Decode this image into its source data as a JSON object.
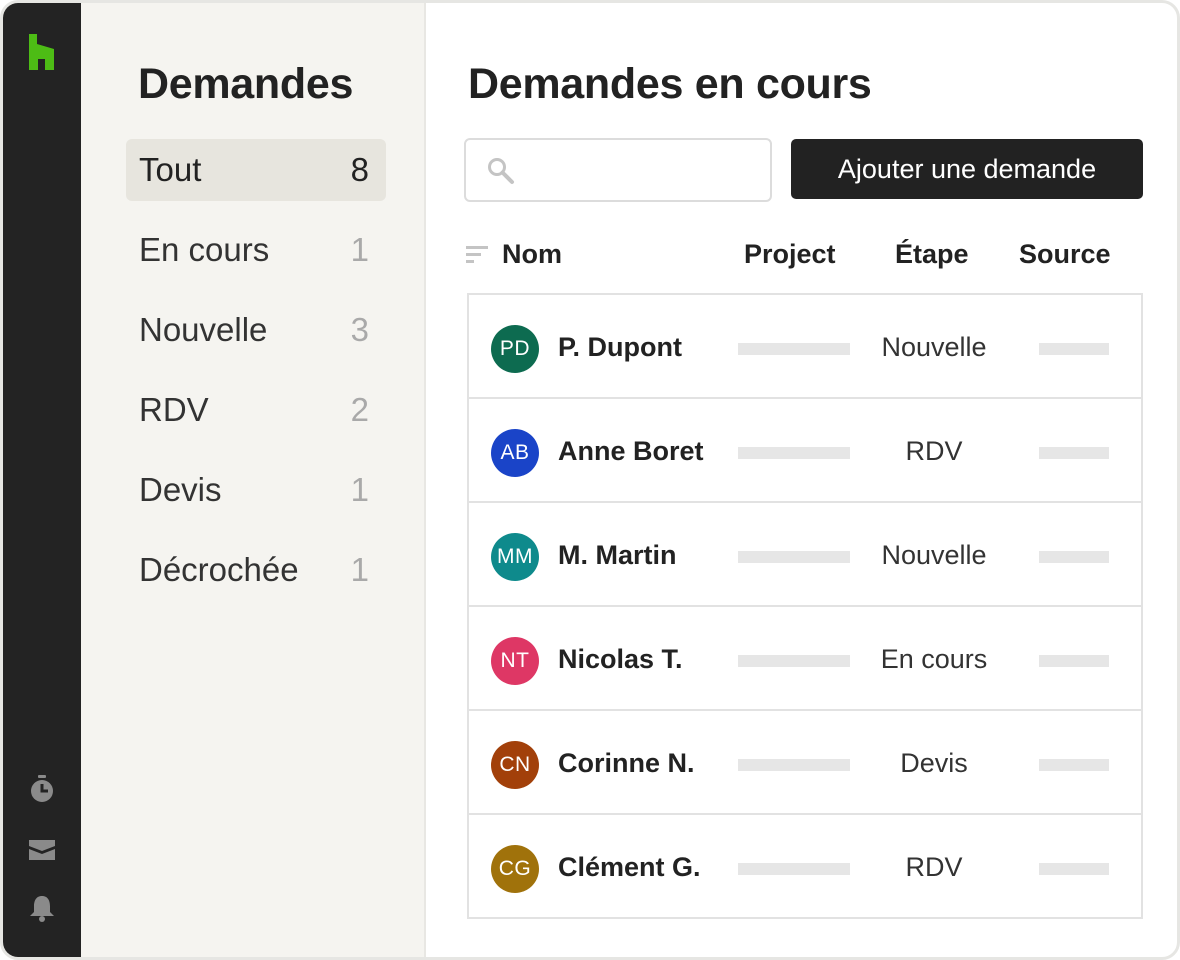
{
  "app": {
    "rail_icons": [
      "houzz-logo-icon",
      "timer-icon",
      "inbox-icon",
      "bell-icon"
    ],
    "brand_color": "#4dbc15"
  },
  "sidebar": {
    "title": "Demandes",
    "filters": [
      {
        "label": "Tout",
        "count": "8",
        "active": true
      },
      {
        "label": "En cours",
        "count": "1"
      },
      {
        "label": "Nouvelle",
        "count": "3"
      },
      {
        "label": "RDV",
        "count": "2"
      },
      {
        "label": "Devis",
        "count": "1"
      },
      {
        "label": "Décrochée",
        "count": "1"
      }
    ]
  },
  "main": {
    "title": "Demandes en cours",
    "search": {
      "placeholder": "",
      "value": "",
      "icon": "search-icon"
    },
    "add_button_label": "Ajouter une demande",
    "columns": {
      "name": "Nom",
      "project": "Project",
      "stage": "Étape",
      "source": "Source"
    },
    "rows": [
      {
        "initials": "PD",
        "name": "P. Dupont",
        "stage": "Nouvelle",
        "avatar_color": "#0d6b50"
      },
      {
        "initials": "AB",
        "name": "Anne Boret",
        "stage": "RDV",
        "avatar_color": "#1a44c8"
      },
      {
        "initials": "MM",
        "name": "M. Martin",
        "stage": "Nouvelle",
        "avatar_color": "#0e8a8c"
      },
      {
        "initials": "NT",
        "name": "Nicolas T.",
        "stage": "En cours",
        "avatar_color": "#de3765"
      },
      {
        "initials": "CN",
        "name": "Corinne N.",
        "stage": "Devis",
        "avatar_color": "#a2400a"
      },
      {
        "initials": "CG",
        "name": "Clément G.",
        "stage": "RDV",
        "avatar_color": "#a0720b"
      }
    ]
  }
}
